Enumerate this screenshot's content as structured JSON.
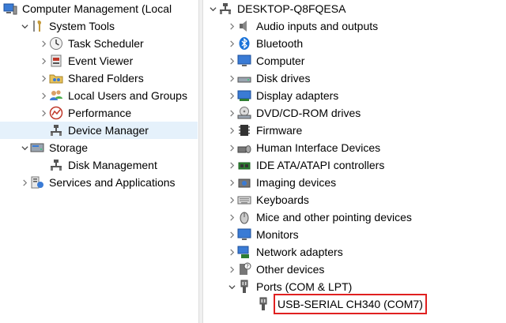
{
  "left_tree": {
    "root": "Computer Management (Local",
    "system_tools": "System Tools",
    "task_scheduler": "Task Scheduler",
    "event_viewer": "Event Viewer",
    "shared_folders": "Shared Folders",
    "local_users": "Local Users and Groups",
    "performance": "Performance",
    "device_manager": "Device Manager",
    "storage": "Storage",
    "disk_management": "Disk Management",
    "services": "Services and Applications"
  },
  "device_tree": {
    "computer_name": "DESKTOP-Q8FQESA",
    "categories": [
      "Audio inputs and outputs",
      "Bluetooth",
      "Computer",
      "Disk drives",
      "Display adapters",
      "DVD/CD-ROM drives",
      "Firmware",
      "Human Interface Devices",
      "IDE ATA/ATAPI controllers",
      "Imaging devices",
      "Keyboards",
      "Mice and other pointing devices",
      "Monitors",
      "Network adapters",
      "Other devices",
      "Ports (COM & LPT)"
    ],
    "port_child": "USB-SERIAL CH340 (COM7)"
  },
  "colors": {
    "highlight_border": "#e02020",
    "selection": "#e5f1fb",
    "bluetooth": "#1a73d9"
  }
}
